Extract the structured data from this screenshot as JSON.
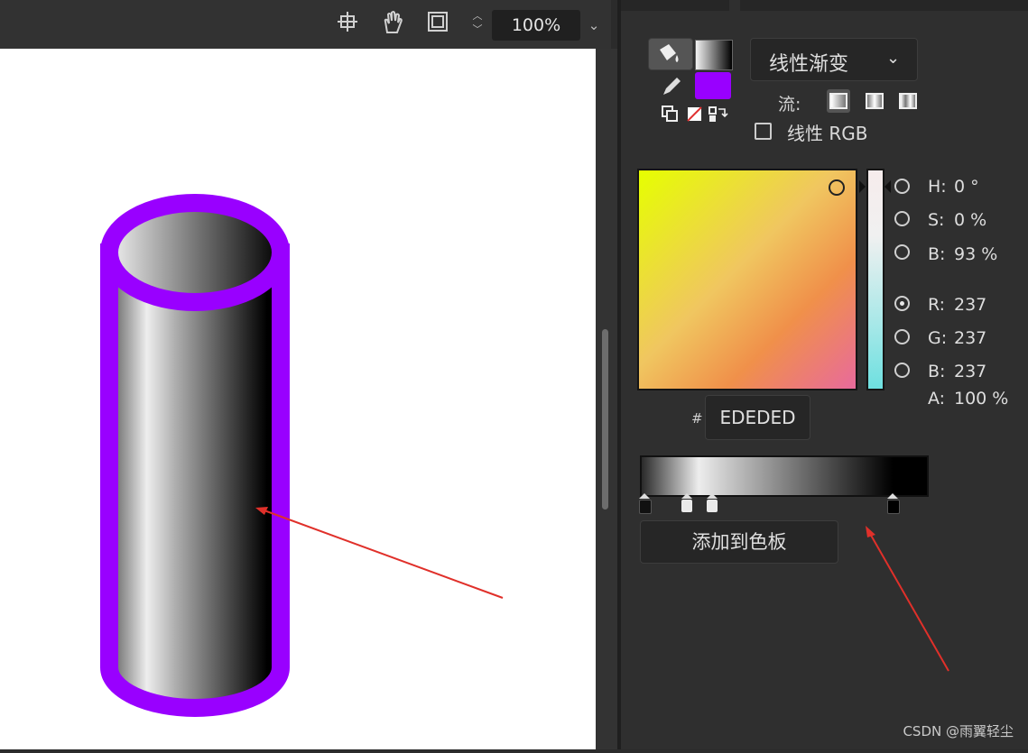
{
  "toolbar": {
    "icons": [
      "crosshair-icon",
      "hand-icon",
      "artboard-icon"
    ],
    "zoom_value": "100%"
  },
  "canvas": {
    "shape": "cylinder",
    "stroke_color": "#9900ff",
    "fill_gradient": [
      "#555555",
      "#eeeeee",
      "#aaaaaa",
      "#000000"
    ]
  },
  "panel": {
    "tabs": [
      "",
      "",
      "",
      "",
      ""
    ],
    "fill_type": "线性渐变",
    "flow_label": "流:",
    "linear_rgb_label": "线性 RGB",
    "stroke_swatch_color": "#9900ff",
    "hsb": [
      {
        "key": "H:",
        "value": "0 °"
      },
      {
        "key": "S:",
        "value": "0 %"
      },
      {
        "key": "B:",
        "value": "93 %"
      }
    ],
    "rgb": [
      {
        "key": "R:",
        "value": "237"
      },
      {
        "key": "G:",
        "value": "237"
      },
      {
        "key": "B:",
        "value": "237"
      }
    ],
    "alpha": {
      "key": "A:",
      "value": "100 %"
    },
    "hex_label": "#",
    "hex_value": "EDEDED",
    "add_to_swatches": "添加到色板"
  },
  "watermark": "CSDN @雨翼轻尘"
}
